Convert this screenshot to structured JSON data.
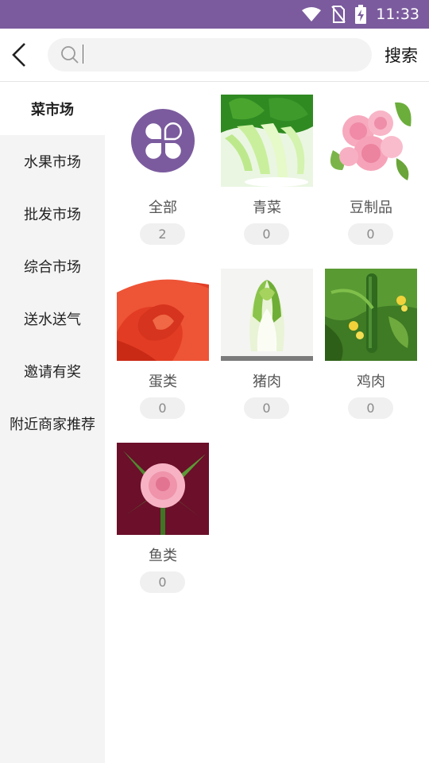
{
  "status": {
    "time": "11:33",
    "color": "#7b5b9e"
  },
  "header": {
    "search_placeholder": "",
    "search_button": "搜索"
  },
  "sidebar": {
    "items": [
      {
        "label": "菜市场",
        "active": true
      },
      {
        "label": "水果市场"
      },
      {
        "label": "批发市场"
      },
      {
        "label": "综合市场"
      },
      {
        "label": "送水送气"
      },
      {
        "label": "邀请有奖"
      },
      {
        "label": "附近商家推荐"
      }
    ]
  },
  "grid": {
    "items": [
      {
        "name": "全部",
        "count": "2",
        "icon": "all-categories-icon"
      },
      {
        "name": "青菜",
        "count": "0",
        "icon": "bok-choy-photo"
      },
      {
        "name": "豆制品",
        "count": "0",
        "icon": "pink-roses-photo"
      },
      {
        "name": "蛋类",
        "count": "0",
        "icon": "red-rose-photo"
      },
      {
        "name": "猪肉",
        "count": "0",
        "icon": "napa-cabbage-photo"
      },
      {
        "name": "鸡肉",
        "count": "0",
        "icon": "cucumber-vine-photo"
      },
      {
        "name": "鱼类",
        "count": "0",
        "icon": "pink-rose-maroon-photo"
      }
    ]
  }
}
